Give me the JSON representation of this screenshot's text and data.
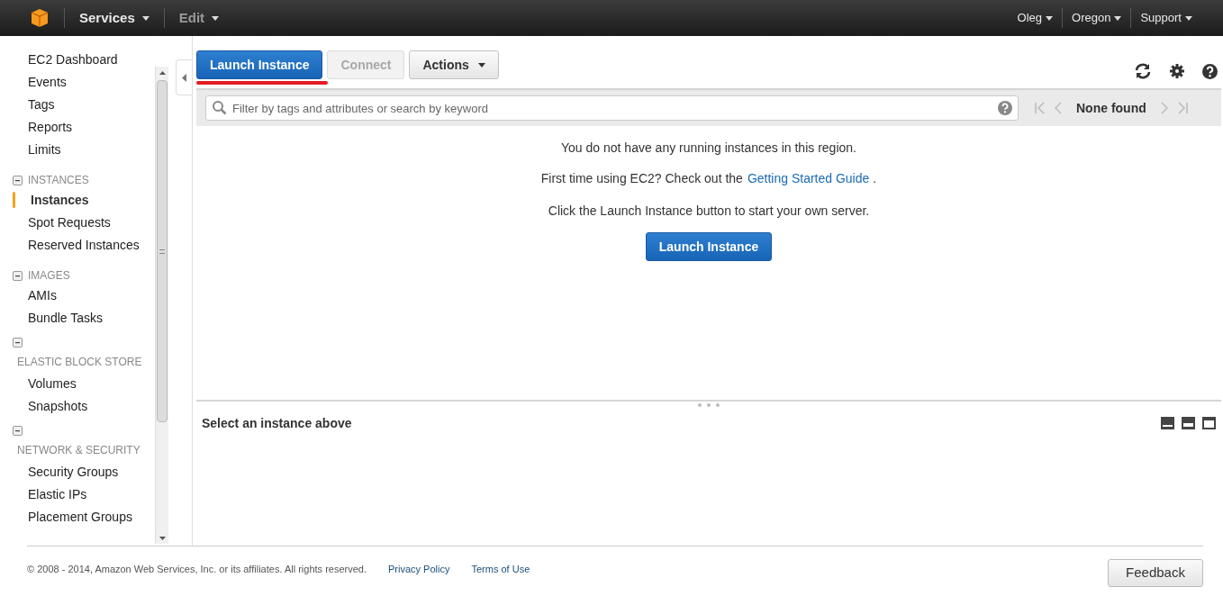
{
  "topbar": {
    "menus": [
      {
        "label": "Services",
        "dim": false
      },
      {
        "label": "Edit",
        "dim": true
      }
    ],
    "right_menus": [
      "Oleg",
      "Oregon",
      "Support"
    ]
  },
  "sidebar": {
    "items": [
      {
        "kind": "link",
        "label": "EC2 Dashboard",
        "selected": false
      },
      {
        "kind": "link",
        "label": "Events",
        "selected": false
      },
      {
        "kind": "link",
        "label": "Tags",
        "selected": false
      },
      {
        "kind": "link",
        "label": "Reports",
        "selected": false
      },
      {
        "kind": "link",
        "label": "Limits",
        "selected": false
      },
      {
        "kind": "section",
        "label": "INSTANCES"
      },
      {
        "kind": "link",
        "label": "Instances",
        "selected": true
      },
      {
        "kind": "link",
        "label": "Spot Requests",
        "selected": false
      },
      {
        "kind": "link",
        "label": "Reserved Instances",
        "selected": false
      },
      {
        "kind": "section",
        "label": "IMAGES"
      },
      {
        "kind": "link",
        "label": "AMIs",
        "selected": false
      },
      {
        "kind": "link",
        "label": "Bundle Tasks",
        "selected": false
      },
      {
        "kind": "section-wrapped",
        "label": "ELASTIC BLOCK STORE"
      },
      {
        "kind": "link",
        "label": "Volumes",
        "selected": false
      },
      {
        "kind": "link",
        "label": "Snapshots",
        "selected": false
      },
      {
        "kind": "section-wrapped",
        "label": "NETWORK & SECURITY"
      },
      {
        "kind": "link",
        "label": "Security Groups",
        "selected": false
      },
      {
        "kind": "link",
        "label": "Elastic IPs",
        "selected": false
      },
      {
        "kind": "link",
        "label": "Placement Groups",
        "selected": false
      }
    ]
  },
  "toolbar": {
    "buttons": [
      {
        "label": "Launch Instance",
        "kind": "primary",
        "disabled": false,
        "underlined": true
      },
      {
        "label": "Connect",
        "kind": "plain",
        "disabled": true,
        "underlined": false
      },
      {
        "label": "Actions",
        "kind": "menu",
        "disabled": false,
        "underlined": false
      }
    ]
  },
  "filter": {
    "placeholder": "Filter by tags and attributes or search by keyword",
    "pager": "None found"
  },
  "empty_state": {
    "line1": "You do not have any running instances in this region.",
    "line2": "First time using EC2? Check out the",
    "link": "Getting Started Guide",
    "line2_end": ".",
    "line3": "Click the Launch Instance button to start your own server.",
    "button": "Launch Instance"
  },
  "details": {
    "title": "Select an instance above"
  },
  "footer": {
    "copyright": "© 2008 - 2014, Amazon Web Services, Inc. or its affiliates. All rights reserved.",
    "links": [
      "Privacy Policy",
      "Terms of Use"
    ],
    "feedback": "Feedback"
  }
}
